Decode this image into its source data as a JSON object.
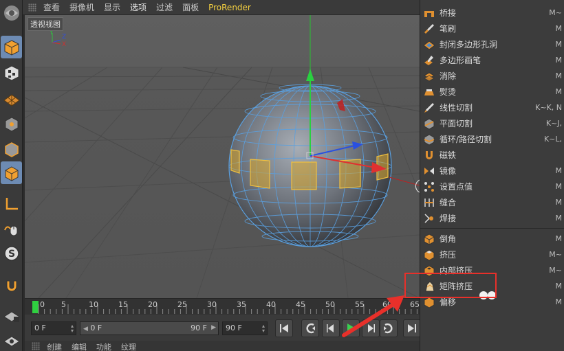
{
  "menubar": {
    "items": [
      {
        "label": "查看"
      },
      {
        "label": "摄像机"
      },
      {
        "label": "显示"
      },
      {
        "label": "选项"
      },
      {
        "label": "过滤"
      },
      {
        "label": "面板"
      },
      {
        "label": "ProRender"
      }
    ]
  },
  "viewport": {
    "label": "透视视图",
    "axis_y": "Y",
    "axis_z": "Z",
    "axis_x": "X"
  },
  "timeline": {
    "ticks": [
      "0",
      "5",
      "10",
      "15",
      "20",
      "25",
      "30",
      "35",
      "40",
      "45",
      "50",
      "55",
      "60",
      "65"
    ],
    "current_frame": "0"
  },
  "transport": {
    "current": "0 F",
    "range_start": "0 F",
    "range_end": "90 F",
    "end": "90 F"
  },
  "bottom_tabs": [
    {
      "label": "创建"
    },
    {
      "label": "编辑"
    },
    {
      "label": "功能"
    },
    {
      "label": "纹理"
    }
  ],
  "right_menu": {
    "items": [
      {
        "label": "桥接",
        "shortcut": "M~",
        "icon": "bridge-icon"
      },
      {
        "label": "笔刷",
        "shortcut": "M",
        "icon": "brush-icon"
      },
      {
        "label": "封闭多边形孔洞",
        "shortcut": "M",
        "icon": "close-polygon-hole-icon"
      },
      {
        "label": "多边形画笔",
        "shortcut": "M",
        "icon": "polygon-pen-icon"
      },
      {
        "label": "消除",
        "shortcut": "M",
        "icon": "dissolve-icon"
      },
      {
        "label": "熨烫",
        "shortcut": "M",
        "icon": "iron-icon"
      },
      {
        "label": "线性切割",
        "shortcut": "K~K, N",
        "icon": "line-cut-icon"
      },
      {
        "label": "平面切割",
        "shortcut": "K~J, ",
        "icon": "plane-cut-icon"
      },
      {
        "label": "循环/路径切割",
        "shortcut": "K~L, ",
        "icon": "loop-cut-icon"
      },
      {
        "label": "磁铁",
        "shortcut": "",
        "icon": "magnet-icon"
      },
      {
        "label": "镜像",
        "shortcut": "M",
        "icon": "mirror-icon"
      },
      {
        "label": "设置点值",
        "shortcut": "M",
        "icon": "set-point-value-icon"
      },
      {
        "label": "缝合",
        "shortcut": "M",
        "icon": "stitch-icon"
      },
      {
        "label": "焊接",
        "shortcut": "M",
        "icon": "weld-icon"
      },
      {
        "label": "倒角",
        "shortcut": "M",
        "icon": "bevel-icon"
      },
      {
        "label": "挤压",
        "shortcut": "M~",
        "icon": "extrude-icon"
      },
      {
        "label": "内部挤压",
        "shortcut": "M~",
        "icon": "extrude-inner-icon"
      },
      {
        "label": "矩阵挤压",
        "shortcut": "M",
        "icon": "matrix-extrude-icon"
      },
      {
        "label": "偏移",
        "shortcut": "M",
        "icon": "smooth-shift-icon"
      }
    ]
  },
  "colors": {
    "accent": "#6d8bb3",
    "brand": "#f5d040",
    "annotation": "#e8302a",
    "selection": "#e0b030"
  }
}
